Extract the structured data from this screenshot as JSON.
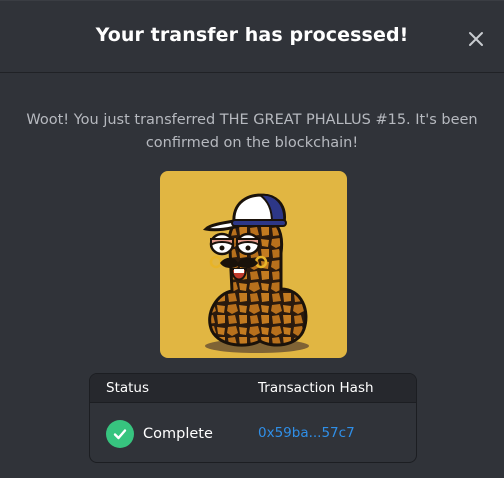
{
  "dialog": {
    "title": "Your transfer has processed!",
    "close_icon": "close-icon",
    "message": "Woot! You just transferred THE GREAT PHALLUS #15. It's been confirmed on the blockchain!"
  },
  "nft": {
    "background_color": "#e1b642"
  },
  "table": {
    "headers": {
      "status": "Status",
      "hash": "Transaction Hash"
    },
    "row": {
      "status": "Complete",
      "status_icon": "check-circle-icon",
      "status_color": "#37c47f",
      "hash": "0x59ba...57c7",
      "hash_color": "#2f8fe8"
    }
  }
}
